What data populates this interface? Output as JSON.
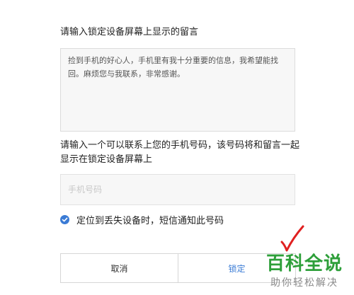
{
  "message_section": {
    "label": "请输入锁定设备屏幕上显示的留言",
    "message_text": "捡到手机的好心人，手机里有我十分重要的信息，我希望能找回。麻烦您与我联系，非常感谢。"
  },
  "phone_section": {
    "label": "请输入一个可以联系上您的手机号码，该号码将和留言一起显示在锁定设备屏幕上",
    "phone_value": "",
    "placeholder": "手机号码"
  },
  "notify_option": {
    "checked": true,
    "label": "定位到丢失设备时，短信通知此号码"
  },
  "buttons": {
    "cancel": "取消",
    "lock": "锁定"
  },
  "watermark": {
    "main": "百科全说",
    "sub": "助你轻松解决"
  },
  "colors": {
    "accent": "#3a7bd5",
    "watermark_green": "#2e9f3a",
    "annotation_red": "#e02020"
  }
}
